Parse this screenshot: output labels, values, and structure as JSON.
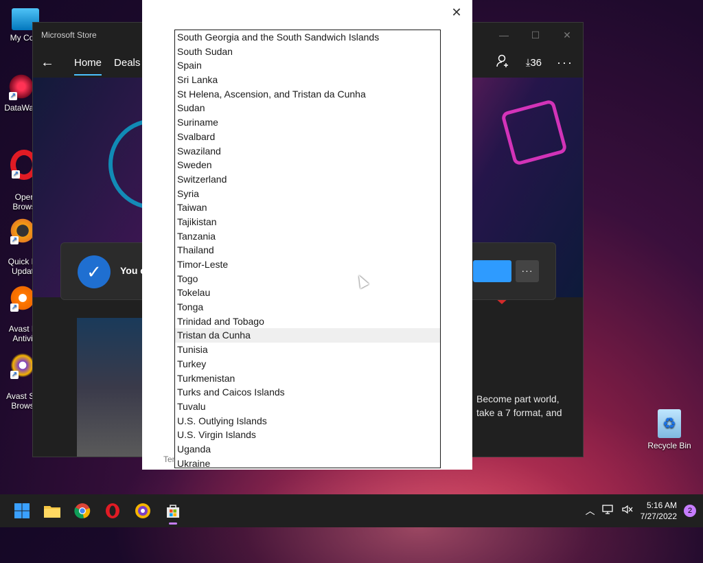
{
  "desktop": {
    "icons": [
      {
        "label": "My Com",
        "icon": "computer-icon"
      },
      {
        "label": "DataWag",
        "icon": "datawag-icon"
      },
      {
        "label": "Oper\nBrows",
        "icon": "opera-icon"
      },
      {
        "label": "Quick D\nUpdat",
        "icon": "quick-driver-icon"
      },
      {
        "label": "Avast F\nAntivi",
        "icon": "avast-icon"
      },
      {
        "label": "Avast Se\nBrows",
        "icon": "avast-browser-icon"
      }
    ],
    "recycle_bin": {
      "label": "Recycle Bin",
      "icon": "recycle-bin-icon"
    }
  },
  "store": {
    "title": "Microsoft Store",
    "nav": {
      "back": "←",
      "tabs": [
        "Home",
        "Deals"
      ],
      "downloads": "36"
    },
    "notification": {
      "text": "You c"
    },
    "description": "Become part world, take a 7 format, and"
  },
  "dialog": {
    "footer": "Ter",
    "countries": [
      "South Georgia and the South Sandwich Islands",
      "South Sudan",
      "Spain",
      "Sri Lanka",
      "St Helena, Ascension, and Tristan da Cunha",
      "Sudan",
      "Suriname",
      "Svalbard",
      "Swaziland",
      "Sweden",
      "Switzerland",
      "Syria",
      "Taiwan",
      "Tajikistan",
      "Tanzania",
      "Thailand",
      "Timor-Leste",
      "Togo",
      "Tokelau",
      "Tonga",
      "Trinidad and Tobago",
      "Tristan da Cunha",
      "Tunisia",
      "Turkey",
      "Turkmenistan",
      "Turks and Caicos Islands",
      "Tuvalu",
      "U.S. Outlying Islands",
      "U.S. Virgin Islands",
      "Uganda",
      "Ukraine"
    ],
    "hovered": "Tristan da Cunha"
  },
  "taskbar": {
    "apps": [
      "windows-start-icon",
      "file-explorer-icon",
      "chrome-icon",
      "opera-icon",
      "avast-browser-icon",
      "microsoft-store-icon"
    ],
    "time": "5:16 AM",
    "date": "7/27/2022",
    "notifications": "2"
  }
}
